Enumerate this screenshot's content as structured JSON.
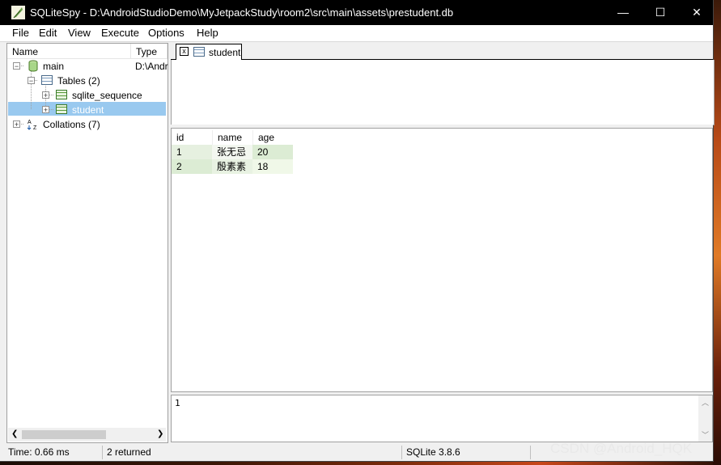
{
  "window": {
    "title": "SQLiteSpy - D:\\AndroidStudioDemo\\MyJetpackStudy\\room2\\src\\main\\assets\\prestudent.db",
    "minimize_glyph": "—",
    "maximize_glyph": "☐",
    "close_glyph": "✕"
  },
  "menu": [
    "File",
    "Edit",
    "View",
    "Execute",
    "Options",
    "Help"
  ],
  "tree": {
    "columns": [
      "Name",
      "Type"
    ],
    "items": [
      {
        "label": "main",
        "type": "D:\\Andr",
        "icon": "database-icon"
      },
      {
        "label": "Tables (2)",
        "icon": "tables-icon"
      },
      {
        "label": "sqlite_sequence",
        "icon": "table-icon"
      },
      {
        "label": "student",
        "icon": "table-icon"
      },
      {
        "label": "Collations (7)",
        "icon": "collation-icon"
      }
    ],
    "expander_plus": "+",
    "expander_minus": "−"
  },
  "editor": {
    "tab_label": "student",
    "tab_close": "x"
  },
  "grid": {
    "columns": [
      "id",
      "name",
      "age"
    ],
    "rows": [
      [
        "1",
        "张无忌",
        "20"
      ],
      [
        "2",
        "殷素素",
        "18"
      ]
    ]
  },
  "log": {
    "text": "1"
  },
  "status": {
    "time": "Time: 0.66 ms",
    "returned": "2 returned",
    "version": "SQLite 3.8.6"
  },
  "watermark": "CSDN @Android_HQK"
}
